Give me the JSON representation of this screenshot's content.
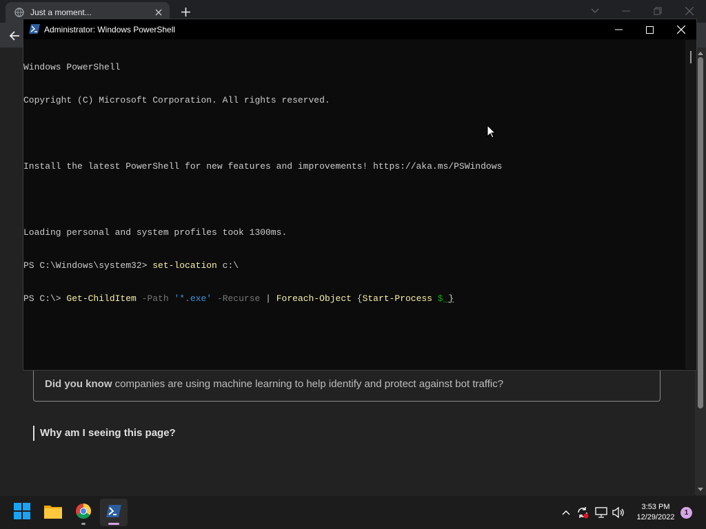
{
  "browser": {
    "tab_title": "Just a moment...",
    "page": {
      "info_bold": "Did you know",
      "info_text": " companies are using machine learning to help identify and protect against bot traffic?",
      "why_heading": "Why am I seeing this page?"
    }
  },
  "powershell": {
    "title": "Administrator: Windows PowerShell",
    "console": {
      "line1": "Windows PowerShell",
      "line2": "Copyright (C) Microsoft Corporation. All rights reserved.",
      "line3": "",
      "line4": "Install the latest PowerShell for new features and improvements! https://aka.ms/PSWindows",
      "line5": "",
      "line6": "Loading personal and system profiles took 1300ms.",
      "line7_prompt": "PS C:\\Windows\\system32> ",
      "line7_cmd": "set-location",
      "line7_arg": " c:\\",
      "line8_prompt": "PS C:\\> ",
      "line8_cmd": "Get-ChildItem",
      "line8_sp1": " ",
      "line8_param1": "-Path",
      "line8_sp2": " ",
      "line8_str": "'*.exe'",
      "line8_sp3": " ",
      "line8_param2": "-Recurse",
      "line8_pipe": " | ",
      "line8_cmd2": "Foreach-Object",
      "line8_brace": " {",
      "line8_cmd3": "Start-Process",
      "line8_sp4": " ",
      "line8_var": "$_",
      "line8_close": "}"
    }
  },
  "taskbar": {
    "time": "3:53 PM",
    "date": "12/29/2022",
    "notification_count": "1",
    "apps": [
      "start-icon",
      "file-explorer-icon",
      "chrome-icon",
      "powershell-icon"
    ]
  },
  "colors": {
    "console_bg": "#0c0c0c",
    "console_text": "#cccccc",
    "cmdlet": "#f9f1a5",
    "parameter": "#767676",
    "string": "#3a96dd",
    "variable": "#13a10e",
    "taskbar_bg": "#1c1c1c",
    "windows_blue": "#0078d4"
  }
}
